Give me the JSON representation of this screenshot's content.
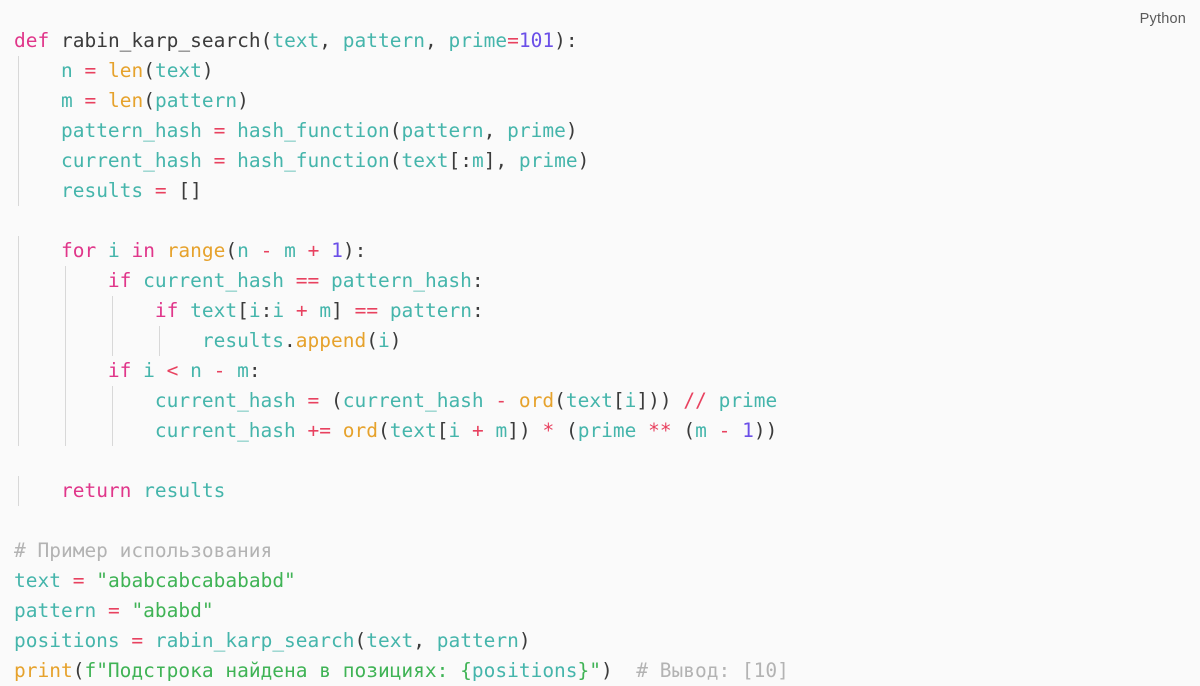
{
  "language_label": "Python",
  "theme": {
    "background": "#fafafa",
    "default_text": "#3b3b3b",
    "keyword": "#e0368a",
    "builtin": "#e6a22c",
    "identifier": "#45b5ab",
    "number": "#6b4fe8",
    "string": "#3fb355",
    "comment": "#b3b3b3",
    "operator": "#e8415f",
    "punctuation": "#3b3b3b",
    "indent_guide": "#d8d8d8",
    "label_text": "#5a5a5a"
  },
  "code": {
    "plain_text": "def rabin_karp_search(text, pattern, prime=101):\n    n = len(text)\n    m = len(pattern)\n    pattern_hash = hash_function(pattern, prime)\n    current_hash = hash_function(text[:m], prime)\n    results = []\n\n    for i in range(n - m + 1):\n        if current_hash == pattern_hash:\n            if text[i:i + m] == pattern:\n                results.append(i)\n        if i < n - m:\n            current_hash = (current_hash - ord(text[i])) // prime\n            current_hash += ord(text[i + m]) * (prime ** (m - 1))\n\n    return results\n\n# Пример использования\ntext = \"ababcabcabababd\"\npattern = \"ababd\"\npositions = rabin_karp_search(text, pattern)\nprint(f\"Подстрока найдена в позициях: {positions}\")  # Вывод: [10]",
    "lines": [
      {
        "n": 1,
        "indent": 0,
        "guides": [],
        "tokens": [
          {
            "t": "def",
            "c": "kw"
          },
          {
            "t": " ",
            "c": "punc"
          },
          {
            "t": "rabin_karp_search",
            "c": "plain"
          },
          {
            "t": "(",
            "c": "punc"
          },
          {
            "t": "text",
            "c": "name"
          },
          {
            "t": ", ",
            "c": "punc"
          },
          {
            "t": "pattern",
            "c": "name"
          },
          {
            "t": ", ",
            "c": "punc"
          },
          {
            "t": "prime",
            "c": "name"
          },
          {
            "t": "=",
            "c": "op"
          },
          {
            "t": "101",
            "c": "num"
          },
          {
            "t": "):",
            "c": "punc"
          }
        ]
      },
      {
        "n": 2,
        "indent": 4,
        "guides": [
          0
        ],
        "tokens": [
          {
            "t": "n",
            "c": "name"
          },
          {
            "t": " ",
            "c": "punc"
          },
          {
            "t": "=",
            "c": "op"
          },
          {
            "t": " ",
            "c": "punc"
          },
          {
            "t": "len",
            "c": "builtin"
          },
          {
            "t": "(",
            "c": "punc"
          },
          {
            "t": "text",
            "c": "name"
          },
          {
            "t": ")",
            "c": "punc"
          }
        ]
      },
      {
        "n": 3,
        "indent": 4,
        "guides": [
          0
        ],
        "tokens": [
          {
            "t": "m",
            "c": "name"
          },
          {
            "t": " ",
            "c": "punc"
          },
          {
            "t": "=",
            "c": "op"
          },
          {
            "t": " ",
            "c": "punc"
          },
          {
            "t": "len",
            "c": "builtin"
          },
          {
            "t": "(",
            "c": "punc"
          },
          {
            "t": "pattern",
            "c": "name"
          },
          {
            "t": ")",
            "c": "punc"
          }
        ]
      },
      {
        "n": 4,
        "indent": 4,
        "guides": [
          0
        ],
        "tokens": [
          {
            "t": "pattern_hash",
            "c": "name"
          },
          {
            "t": " ",
            "c": "punc"
          },
          {
            "t": "=",
            "c": "op"
          },
          {
            "t": " ",
            "c": "punc"
          },
          {
            "t": "hash_function",
            "c": "name"
          },
          {
            "t": "(",
            "c": "punc"
          },
          {
            "t": "pattern",
            "c": "name"
          },
          {
            "t": ", ",
            "c": "punc"
          },
          {
            "t": "prime",
            "c": "name"
          },
          {
            "t": ")",
            "c": "punc"
          }
        ]
      },
      {
        "n": 5,
        "indent": 4,
        "guides": [
          0
        ],
        "tokens": [
          {
            "t": "current_hash",
            "c": "name"
          },
          {
            "t": " ",
            "c": "punc"
          },
          {
            "t": "=",
            "c": "op"
          },
          {
            "t": " ",
            "c": "punc"
          },
          {
            "t": "hash_function",
            "c": "name"
          },
          {
            "t": "(",
            "c": "punc"
          },
          {
            "t": "text",
            "c": "name"
          },
          {
            "t": "[:",
            "c": "punc"
          },
          {
            "t": "m",
            "c": "name"
          },
          {
            "t": "], ",
            "c": "punc"
          },
          {
            "t": "prime",
            "c": "name"
          },
          {
            "t": ")",
            "c": "punc"
          }
        ]
      },
      {
        "n": 6,
        "indent": 4,
        "guides": [
          0
        ],
        "tokens": [
          {
            "t": "results",
            "c": "name"
          },
          {
            "t": " ",
            "c": "punc"
          },
          {
            "t": "=",
            "c": "op"
          },
          {
            "t": " ",
            "c": "punc"
          },
          {
            "t": "[]",
            "c": "punc"
          }
        ]
      },
      {
        "n": 7,
        "indent": 0,
        "guides": [],
        "tokens": []
      },
      {
        "n": 8,
        "indent": 4,
        "guides": [
          0
        ],
        "tokens": [
          {
            "t": "for",
            "c": "kw"
          },
          {
            "t": " ",
            "c": "punc"
          },
          {
            "t": "i",
            "c": "name"
          },
          {
            "t": " ",
            "c": "punc"
          },
          {
            "t": "in",
            "c": "kw"
          },
          {
            "t": " ",
            "c": "punc"
          },
          {
            "t": "range",
            "c": "builtin"
          },
          {
            "t": "(",
            "c": "punc"
          },
          {
            "t": "n",
            "c": "name"
          },
          {
            "t": " ",
            "c": "punc"
          },
          {
            "t": "-",
            "c": "op"
          },
          {
            "t": " ",
            "c": "punc"
          },
          {
            "t": "m",
            "c": "name"
          },
          {
            "t": " ",
            "c": "punc"
          },
          {
            "t": "+",
            "c": "op"
          },
          {
            "t": " ",
            "c": "punc"
          },
          {
            "t": "1",
            "c": "num"
          },
          {
            "t": "):",
            "c": "punc"
          }
        ]
      },
      {
        "n": 9,
        "indent": 8,
        "guides": [
          0,
          1
        ],
        "tokens": [
          {
            "t": "if",
            "c": "kw"
          },
          {
            "t": " ",
            "c": "punc"
          },
          {
            "t": "current_hash",
            "c": "name"
          },
          {
            "t": " ",
            "c": "punc"
          },
          {
            "t": "==",
            "c": "op"
          },
          {
            "t": " ",
            "c": "punc"
          },
          {
            "t": "pattern_hash",
            "c": "name"
          },
          {
            "t": ":",
            "c": "punc"
          }
        ]
      },
      {
        "n": 10,
        "indent": 12,
        "guides": [
          0,
          1,
          2
        ],
        "tokens": [
          {
            "t": "if",
            "c": "kw"
          },
          {
            "t": " ",
            "c": "punc"
          },
          {
            "t": "text",
            "c": "name"
          },
          {
            "t": "[",
            "c": "punc"
          },
          {
            "t": "i",
            "c": "name"
          },
          {
            "t": ":",
            "c": "punc"
          },
          {
            "t": "i",
            "c": "name"
          },
          {
            "t": " ",
            "c": "punc"
          },
          {
            "t": "+",
            "c": "op"
          },
          {
            "t": " ",
            "c": "punc"
          },
          {
            "t": "m",
            "c": "name"
          },
          {
            "t": "] ",
            "c": "punc"
          },
          {
            "t": "==",
            "c": "op"
          },
          {
            "t": " ",
            "c": "punc"
          },
          {
            "t": "pattern",
            "c": "name"
          },
          {
            "t": ":",
            "c": "punc"
          }
        ]
      },
      {
        "n": 11,
        "indent": 16,
        "guides": [
          0,
          1,
          2,
          3
        ],
        "tokens": [
          {
            "t": "results",
            "c": "name"
          },
          {
            "t": ".",
            "c": "punc"
          },
          {
            "t": "append",
            "c": "builtin"
          },
          {
            "t": "(",
            "c": "punc"
          },
          {
            "t": "i",
            "c": "name"
          },
          {
            "t": ")",
            "c": "punc"
          }
        ]
      },
      {
        "n": 12,
        "indent": 8,
        "guides": [
          0,
          1
        ],
        "tokens": [
          {
            "t": "if",
            "c": "kw"
          },
          {
            "t": " ",
            "c": "punc"
          },
          {
            "t": "i",
            "c": "name"
          },
          {
            "t": " ",
            "c": "punc"
          },
          {
            "t": "<",
            "c": "op"
          },
          {
            "t": " ",
            "c": "punc"
          },
          {
            "t": "n",
            "c": "name"
          },
          {
            "t": " ",
            "c": "punc"
          },
          {
            "t": "-",
            "c": "op"
          },
          {
            "t": " ",
            "c": "punc"
          },
          {
            "t": "m",
            "c": "name"
          },
          {
            "t": ":",
            "c": "punc"
          }
        ]
      },
      {
        "n": 13,
        "indent": 12,
        "guides": [
          0,
          1,
          2
        ],
        "tokens": [
          {
            "t": "current_hash",
            "c": "name"
          },
          {
            "t": " ",
            "c": "punc"
          },
          {
            "t": "=",
            "c": "op"
          },
          {
            "t": " ",
            "c": "punc"
          },
          {
            "t": "(",
            "c": "punc"
          },
          {
            "t": "current_hash",
            "c": "name"
          },
          {
            "t": " ",
            "c": "punc"
          },
          {
            "t": "-",
            "c": "op"
          },
          {
            "t": " ",
            "c": "punc"
          },
          {
            "t": "ord",
            "c": "builtin"
          },
          {
            "t": "(",
            "c": "punc"
          },
          {
            "t": "text",
            "c": "name"
          },
          {
            "t": "[",
            "c": "punc"
          },
          {
            "t": "i",
            "c": "name"
          },
          {
            "t": "])) ",
            "c": "punc"
          },
          {
            "t": "//",
            "c": "op"
          },
          {
            "t": " ",
            "c": "punc"
          },
          {
            "t": "prime",
            "c": "name"
          }
        ]
      },
      {
        "n": 14,
        "indent": 12,
        "guides": [
          0,
          1,
          2
        ],
        "tokens": [
          {
            "t": "current_hash",
            "c": "name"
          },
          {
            "t": " ",
            "c": "punc"
          },
          {
            "t": "+=",
            "c": "op"
          },
          {
            "t": " ",
            "c": "punc"
          },
          {
            "t": "ord",
            "c": "builtin"
          },
          {
            "t": "(",
            "c": "punc"
          },
          {
            "t": "text",
            "c": "name"
          },
          {
            "t": "[",
            "c": "punc"
          },
          {
            "t": "i",
            "c": "name"
          },
          {
            "t": " ",
            "c": "punc"
          },
          {
            "t": "+",
            "c": "op"
          },
          {
            "t": " ",
            "c": "punc"
          },
          {
            "t": "m",
            "c": "name"
          },
          {
            "t": "]) ",
            "c": "punc"
          },
          {
            "t": "*",
            "c": "op"
          },
          {
            "t": " ",
            "c": "punc"
          },
          {
            "t": "(",
            "c": "punc"
          },
          {
            "t": "prime",
            "c": "name"
          },
          {
            "t": " ",
            "c": "punc"
          },
          {
            "t": "**",
            "c": "op"
          },
          {
            "t": " ",
            "c": "punc"
          },
          {
            "t": "(",
            "c": "punc"
          },
          {
            "t": "m",
            "c": "name"
          },
          {
            "t": " ",
            "c": "punc"
          },
          {
            "t": "-",
            "c": "op"
          },
          {
            "t": " ",
            "c": "punc"
          },
          {
            "t": "1",
            "c": "num"
          },
          {
            "t": "))",
            "c": "punc"
          }
        ]
      },
      {
        "n": 15,
        "indent": 0,
        "guides": [],
        "tokens": []
      },
      {
        "n": 16,
        "indent": 4,
        "guides": [
          0
        ],
        "tokens": [
          {
            "t": "return",
            "c": "kw"
          },
          {
            "t": " ",
            "c": "punc"
          },
          {
            "t": "results",
            "c": "name"
          }
        ]
      },
      {
        "n": 17,
        "indent": 0,
        "guides": [],
        "tokens": []
      },
      {
        "n": 18,
        "indent": 0,
        "guides": [],
        "tokens": [
          {
            "t": "# Пример использования",
            "c": "com"
          }
        ]
      },
      {
        "n": 19,
        "indent": 0,
        "guides": [],
        "tokens": [
          {
            "t": "text",
            "c": "name"
          },
          {
            "t": " ",
            "c": "punc"
          },
          {
            "t": "=",
            "c": "op"
          },
          {
            "t": " ",
            "c": "punc"
          },
          {
            "t": "\"ababcabcabababd\"",
            "c": "str"
          }
        ]
      },
      {
        "n": 20,
        "indent": 0,
        "guides": [],
        "tokens": [
          {
            "t": "pattern",
            "c": "name"
          },
          {
            "t": " ",
            "c": "punc"
          },
          {
            "t": "=",
            "c": "op"
          },
          {
            "t": " ",
            "c": "punc"
          },
          {
            "t": "\"ababd\"",
            "c": "str"
          }
        ]
      },
      {
        "n": 21,
        "indent": 0,
        "guides": [],
        "tokens": [
          {
            "t": "positions",
            "c": "name"
          },
          {
            "t": " ",
            "c": "punc"
          },
          {
            "t": "=",
            "c": "op"
          },
          {
            "t": " ",
            "c": "punc"
          },
          {
            "t": "rabin_karp_search",
            "c": "name"
          },
          {
            "t": "(",
            "c": "punc"
          },
          {
            "t": "text",
            "c": "name"
          },
          {
            "t": ", ",
            "c": "punc"
          },
          {
            "t": "pattern",
            "c": "name"
          },
          {
            "t": ")",
            "c": "punc"
          }
        ]
      },
      {
        "n": 22,
        "indent": 0,
        "guides": [],
        "tokens": [
          {
            "t": "print",
            "c": "builtin"
          },
          {
            "t": "(",
            "c": "punc"
          },
          {
            "t": "f\"Подстрока найдена в позициях: {",
            "c": "str"
          },
          {
            "t": "positions",
            "c": "name"
          },
          {
            "t": "}\"",
            "c": "str"
          },
          {
            "t": ")",
            "c": "punc"
          },
          {
            "t": "  ",
            "c": "punc"
          },
          {
            "t": "# Вывод: [10]",
            "c": "com"
          }
        ]
      }
    ]
  }
}
